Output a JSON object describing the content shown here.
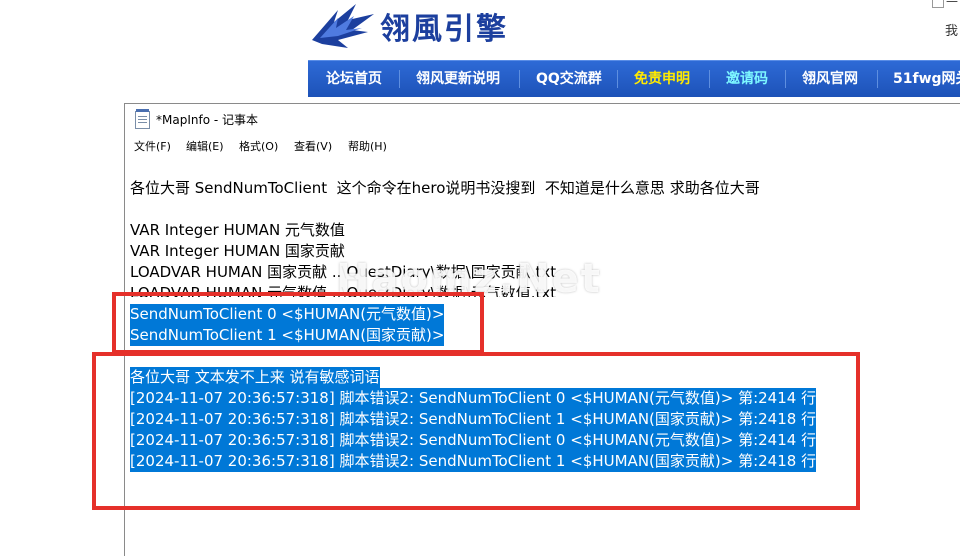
{
  "site": {
    "logo_text": "翎風引擎",
    "corner_text": "我",
    "corner_dash": "—",
    "nav": [
      {
        "label": "论坛首页",
        "color": "#ffffff"
      },
      {
        "label": "翎风更新说明",
        "color": "#ffffff"
      },
      {
        "label": "QQ交流群",
        "color": "#ffffff"
      },
      {
        "label": "免责申明",
        "color": "#ffea00"
      },
      {
        "label": "邀请码",
        "color": "#7df7ff"
      },
      {
        "label": "翎风官网",
        "color": "#ffffff"
      },
      {
        "label": "51fwg网关",
        "color": "#ffffff"
      }
    ]
  },
  "notepad": {
    "title": "*MapInfo - 记事本",
    "menu": [
      "文件(F)",
      "编辑(E)",
      "格式(O)",
      "查看(V)",
      "帮助(H)"
    ],
    "lines": [
      "各位大哥 SendNumToClient  这个命令在hero说明书没搜到  不知道是什么意思 求助各位大哥",
      "",
      "VAR Integer HUMAN 元气数值",
      "VAR Integer HUMAN 国家贡献",
      "LOADVAR HUMAN 国家贡献 ..\\QuestDiary\\数据\\国家贡献.txt",
      "LOADVAR HUMAN 元气数值 ..\\QuestDiary\\数据\\元气数值.txt",
      "SendNumToClient 0 <$HUMAN(元气数值)>",
      "SendNumToClient 1 <$HUMAN(国家贡献)>",
      "",
      "各位大哥 文本发不上来 说有敏感词语",
      "[2024-11-07 20:36:57:318] 脚本错误2: SendNumToClient 0 <$HUMAN(元气数值)> 第:2414 行",
      "[2024-11-07 20:36:57:318] 脚本错误2: SendNumToClient 1 <$HUMAN(国家贡献)> 第:2418 行",
      "[2024-11-07 20:36:57:318] 脚本错误2: SendNumToClient 0 <$HUMAN(元气数值)> 第:2414 行",
      "[2024-11-07 20:36:57:318] 脚本错误2: SendNumToClient 1 <$HUMAN(国家贡献)> 第:2418 行"
    ],
    "selection_color": "#0078d7"
  },
  "watermark": "Haomz.Net",
  "annotation_color": "#e5302a"
}
